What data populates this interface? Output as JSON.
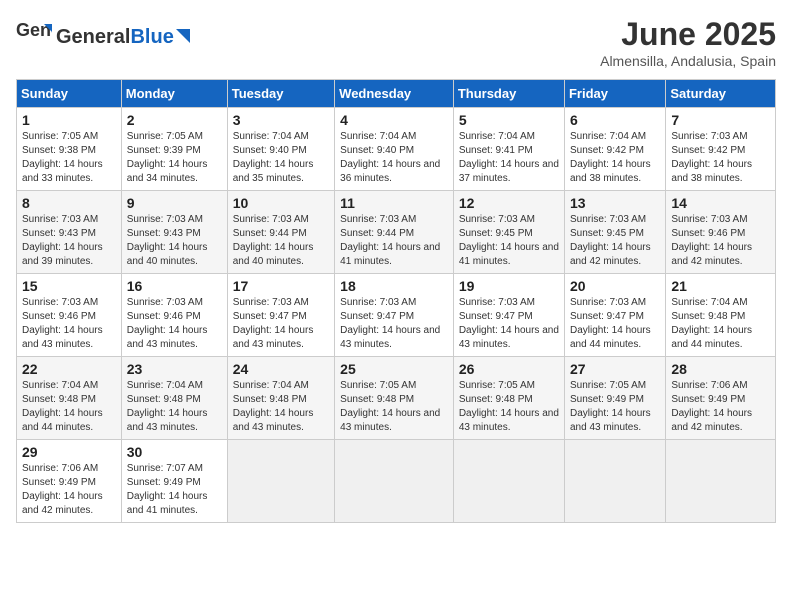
{
  "header": {
    "logo_general": "General",
    "logo_blue": "Blue",
    "month_title": "June 2025",
    "subtitle": "Almensilla, Andalusia, Spain"
  },
  "calendar": {
    "days_of_week": [
      "Sunday",
      "Monday",
      "Tuesday",
      "Wednesday",
      "Thursday",
      "Friday",
      "Saturday"
    ],
    "weeks": [
      [
        {
          "day": "",
          "info": ""
        },
        {
          "day": "",
          "info": ""
        },
        {
          "day": "",
          "info": ""
        },
        {
          "day": "",
          "info": ""
        },
        {
          "day": "",
          "info": ""
        },
        {
          "day": "",
          "info": ""
        },
        {
          "day": "",
          "info": ""
        }
      ],
      [
        {
          "day": "1",
          "sunrise": "Sunrise: 7:05 AM",
          "sunset": "Sunset: 9:38 PM",
          "daylight": "Daylight: 14 hours and 33 minutes."
        },
        {
          "day": "2",
          "sunrise": "Sunrise: 7:05 AM",
          "sunset": "Sunset: 9:39 PM",
          "daylight": "Daylight: 14 hours and 34 minutes."
        },
        {
          "day": "3",
          "sunrise": "Sunrise: 7:04 AM",
          "sunset": "Sunset: 9:40 PM",
          "daylight": "Daylight: 14 hours and 35 minutes."
        },
        {
          "day": "4",
          "sunrise": "Sunrise: 7:04 AM",
          "sunset": "Sunset: 9:40 PM",
          "daylight": "Daylight: 14 hours and 36 minutes."
        },
        {
          "day": "5",
          "sunrise": "Sunrise: 7:04 AM",
          "sunset": "Sunset: 9:41 PM",
          "daylight": "Daylight: 14 hours and 37 minutes."
        },
        {
          "day": "6",
          "sunrise": "Sunrise: 7:04 AM",
          "sunset": "Sunset: 9:42 PM",
          "daylight": "Daylight: 14 hours and 38 minutes."
        },
        {
          "day": "7",
          "sunrise": "Sunrise: 7:03 AM",
          "sunset": "Sunset: 9:42 PM",
          "daylight": "Daylight: 14 hours and 38 minutes."
        }
      ],
      [
        {
          "day": "8",
          "sunrise": "Sunrise: 7:03 AM",
          "sunset": "Sunset: 9:43 PM",
          "daylight": "Daylight: 14 hours and 39 minutes."
        },
        {
          "day": "9",
          "sunrise": "Sunrise: 7:03 AM",
          "sunset": "Sunset: 9:43 PM",
          "daylight": "Daylight: 14 hours and 40 minutes."
        },
        {
          "day": "10",
          "sunrise": "Sunrise: 7:03 AM",
          "sunset": "Sunset: 9:44 PM",
          "daylight": "Daylight: 14 hours and 40 minutes."
        },
        {
          "day": "11",
          "sunrise": "Sunrise: 7:03 AM",
          "sunset": "Sunset: 9:44 PM",
          "daylight": "Daylight: 14 hours and 41 minutes."
        },
        {
          "day": "12",
          "sunrise": "Sunrise: 7:03 AM",
          "sunset": "Sunset: 9:45 PM",
          "daylight": "Daylight: 14 hours and 41 minutes."
        },
        {
          "day": "13",
          "sunrise": "Sunrise: 7:03 AM",
          "sunset": "Sunset: 9:45 PM",
          "daylight": "Daylight: 14 hours and 42 minutes."
        },
        {
          "day": "14",
          "sunrise": "Sunrise: 7:03 AM",
          "sunset": "Sunset: 9:46 PM",
          "daylight": "Daylight: 14 hours and 42 minutes."
        }
      ],
      [
        {
          "day": "15",
          "sunrise": "Sunrise: 7:03 AM",
          "sunset": "Sunset: 9:46 PM",
          "daylight": "Daylight: 14 hours and 43 minutes."
        },
        {
          "day": "16",
          "sunrise": "Sunrise: 7:03 AM",
          "sunset": "Sunset: 9:46 PM",
          "daylight": "Daylight: 14 hours and 43 minutes."
        },
        {
          "day": "17",
          "sunrise": "Sunrise: 7:03 AM",
          "sunset": "Sunset: 9:47 PM",
          "daylight": "Daylight: 14 hours and 43 minutes."
        },
        {
          "day": "18",
          "sunrise": "Sunrise: 7:03 AM",
          "sunset": "Sunset: 9:47 PM",
          "daylight": "Daylight: 14 hours and 43 minutes."
        },
        {
          "day": "19",
          "sunrise": "Sunrise: 7:03 AM",
          "sunset": "Sunset: 9:47 PM",
          "daylight": "Daylight: 14 hours and 43 minutes."
        },
        {
          "day": "20",
          "sunrise": "Sunrise: 7:03 AM",
          "sunset": "Sunset: 9:47 PM",
          "daylight": "Daylight: 14 hours and 44 minutes."
        },
        {
          "day": "21",
          "sunrise": "Sunrise: 7:04 AM",
          "sunset": "Sunset: 9:48 PM",
          "daylight": "Daylight: 14 hours and 44 minutes."
        }
      ],
      [
        {
          "day": "22",
          "sunrise": "Sunrise: 7:04 AM",
          "sunset": "Sunset: 9:48 PM",
          "daylight": "Daylight: 14 hours and 44 minutes."
        },
        {
          "day": "23",
          "sunrise": "Sunrise: 7:04 AM",
          "sunset": "Sunset: 9:48 PM",
          "daylight": "Daylight: 14 hours and 43 minutes."
        },
        {
          "day": "24",
          "sunrise": "Sunrise: 7:04 AM",
          "sunset": "Sunset: 9:48 PM",
          "daylight": "Daylight: 14 hours and 43 minutes."
        },
        {
          "day": "25",
          "sunrise": "Sunrise: 7:05 AM",
          "sunset": "Sunset: 9:48 PM",
          "daylight": "Daylight: 14 hours and 43 minutes."
        },
        {
          "day": "26",
          "sunrise": "Sunrise: 7:05 AM",
          "sunset": "Sunset: 9:48 PM",
          "daylight": "Daylight: 14 hours and 43 minutes."
        },
        {
          "day": "27",
          "sunrise": "Sunrise: 7:05 AM",
          "sunset": "Sunset: 9:49 PM",
          "daylight": "Daylight: 14 hours and 43 minutes."
        },
        {
          "day": "28",
          "sunrise": "Sunrise: 7:06 AM",
          "sunset": "Sunset: 9:49 PM",
          "daylight": "Daylight: 14 hours and 42 minutes."
        }
      ],
      [
        {
          "day": "29",
          "sunrise": "Sunrise: 7:06 AM",
          "sunset": "Sunset: 9:49 PM",
          "daylight": "Daylight: 14 hours and 42 minutes."
        },
        {
          "day": "30",
          "sunrise": "Sunrise: 7:07 AM",
          "sunset": "Sunset: 9:49 PM",
          "daylight": "Daylight: 14 hours and 41 minutes."
        },
        {
          "day": "",
          "info": ""
        },
        {
          "day": "",
          "info": ""
        },
        {
          "day": "",
          "info": ""
        },
        {
          "day": "",
          "info": ""
        },
        {
          "day": "",
          "info": ""
        }
      ]
    ]
  }
}
